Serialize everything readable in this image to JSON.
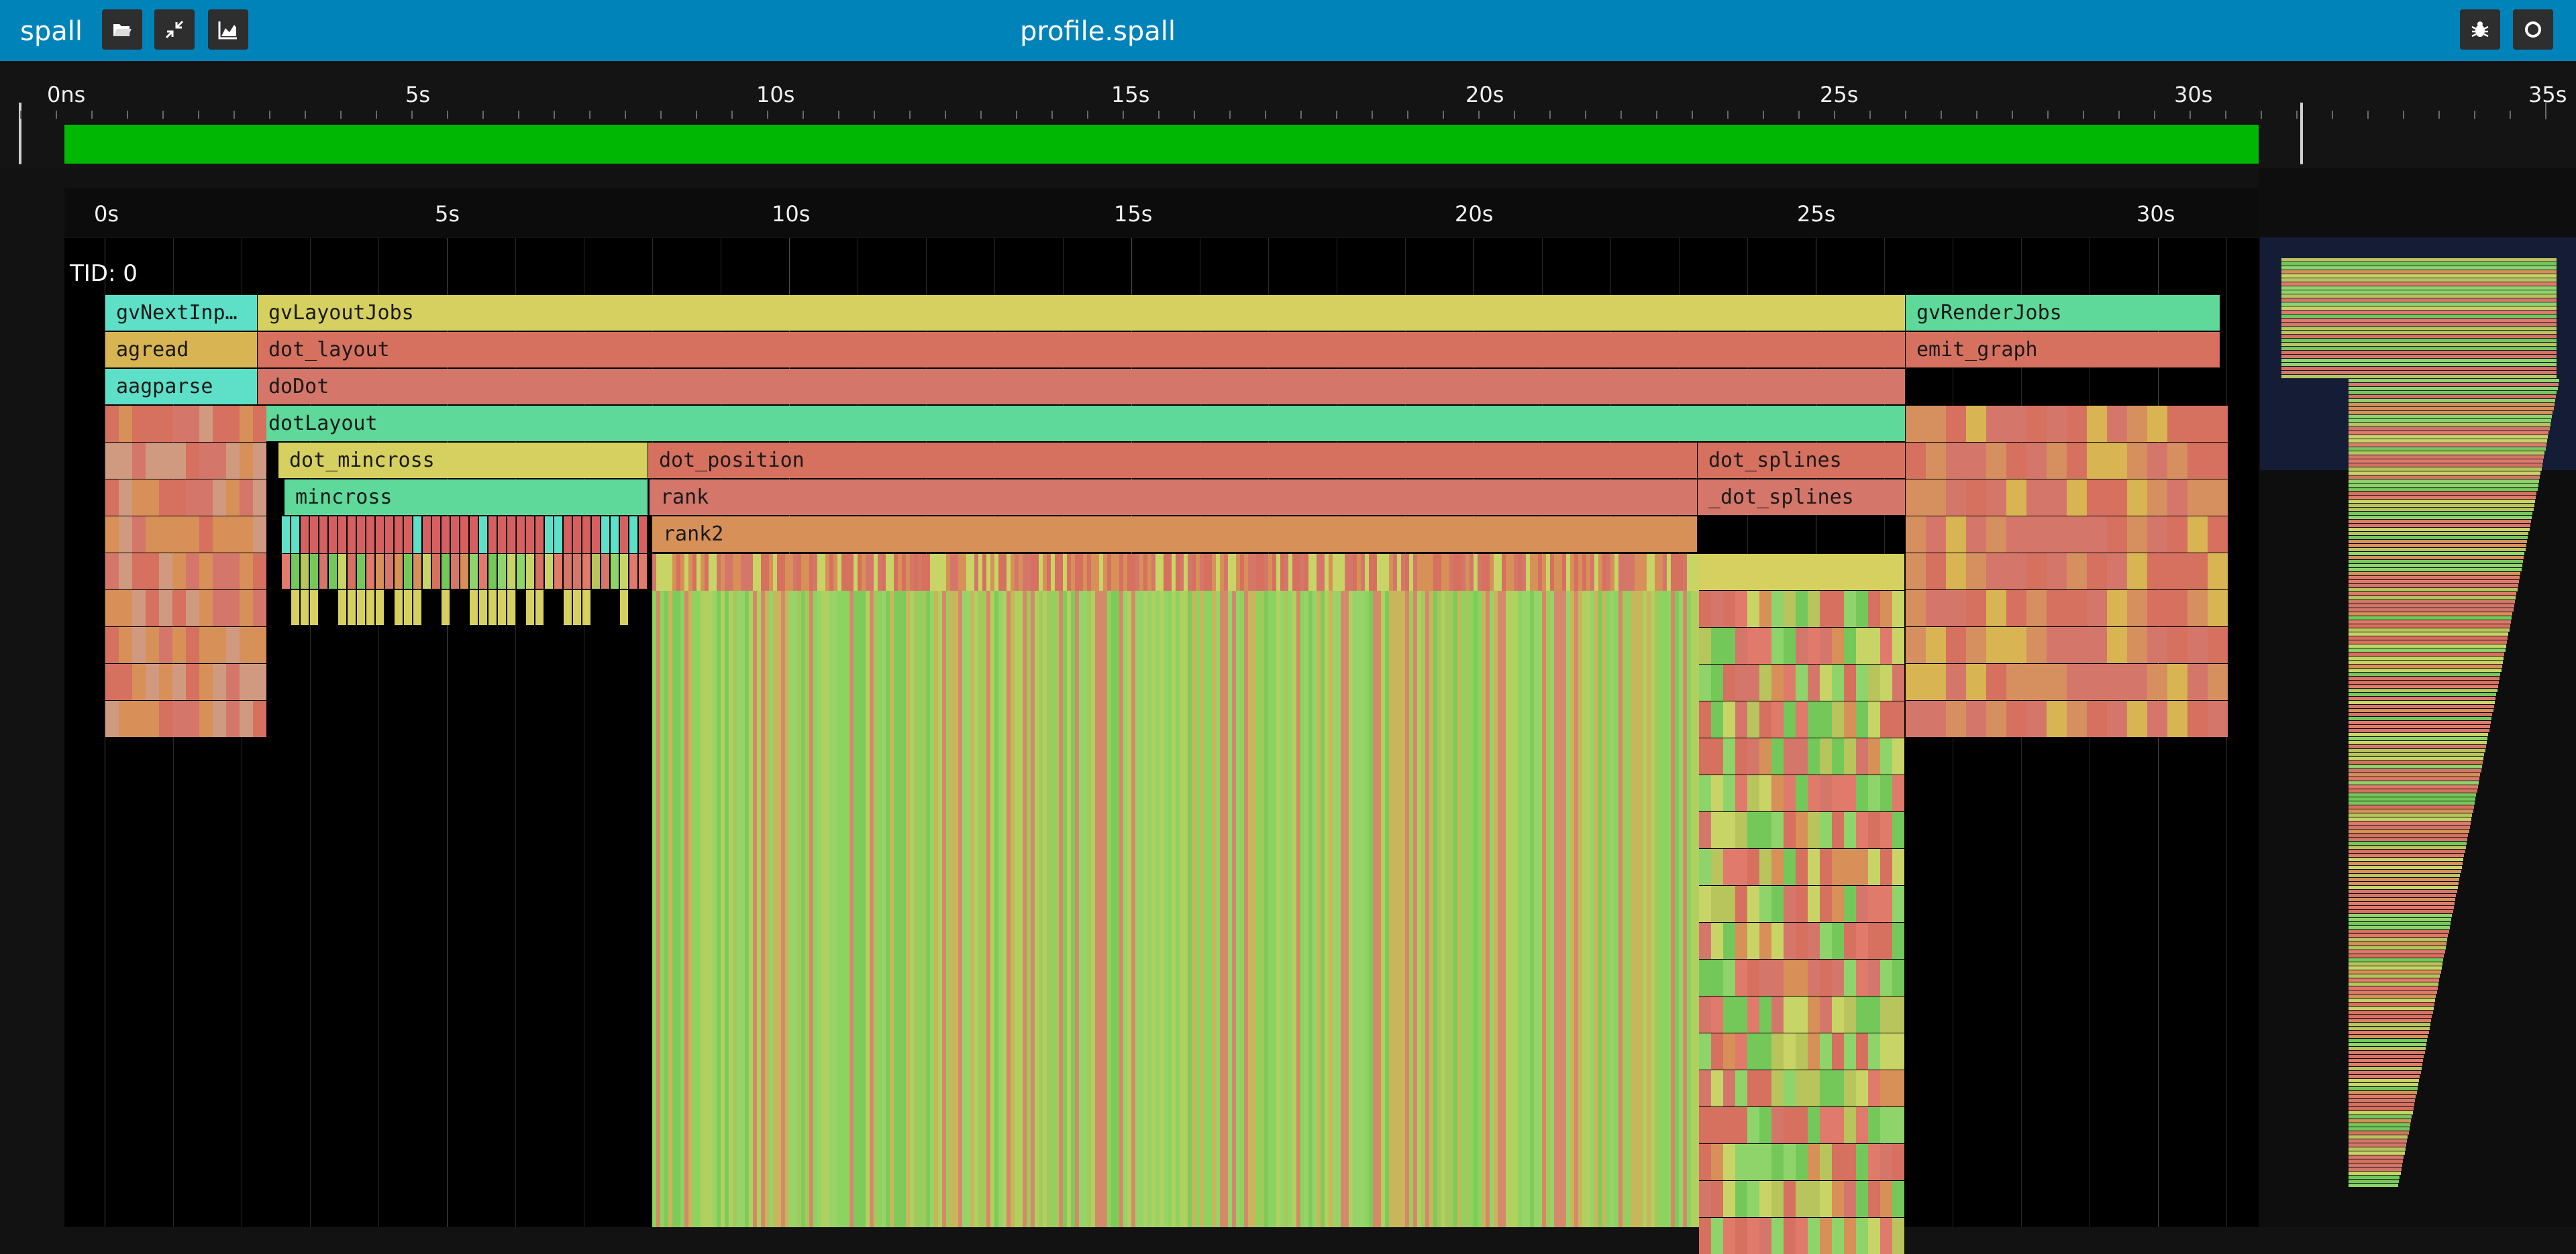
{
  "app": {
    "name": "spall",
    "file_title": "profile.spall"
  },
  "toolbar": {
    "left_icons": [
      "open-file-icon",
      "collapse-icon",
      "chart-icon"
    ],
    "right_icons": [
      "bug-icon",
      "record-icon"
    ]
  },
  "overview": {
    "tick_labels": [
      "0ns",
      "5s",
      "10s",
      "15s",
      "20s",
      "25s",
      "30s",
      "35s"
    ]
  },
  "ruler": {
    "tick_labels": [
      "0s",
      "5s",
      "10s",
      "15s",
      "20s",
      "25s",
      "30s"
    ]
  },
  "thread": {
    "label": "TID: 0"
  },
  "spans": [
    {
      "name": "gvNextInp…",
      "color": "#5ee0c8"
    },
    {
      "name": "gvLayoutJobs",
      "color": "#d6d060"
    },
    {
      "name": "gvRenderJobs",
      "color": "#5ed99a"
    },
    {
      "name": "agread",
      "color": "#d8b452"
    },
    {
      "name": "dot_layout",
      "color": "#d6705f"
    },
    {
      "name": "emit_graph",
      "color": "#d6705f"
    },
    {
      "name": "aagparse",
      "color": "#5ee0c8"
    },
    {
      "name": "doDot",
      "color": "#d4776a"
    },
    {
      "name": "dotLayout",
      "color": "#5ed99a"
    },
    {
      "name": "dot_mincross",
      "color": "#d6d060"
    },
    {
      "name": "dot_position",
      "color": "#d6705f"
    },
    {
      "name": "dot_splines",
      "color": "#d6705f"
    },
    {
      "name": "mincross",
      "color": "#5ed99a"
    },
    {
      "name": "rank",
      "color": "#d4776a"
    },
    {
      "name": "_dot_splines",
      "color": "#d4776a"
    },
    {
      "name": "rank2",
      "color": "#d69058"
    }
  ],
  "colors": {
    "topbar": "#0083b9",
    "overview_bar": "#00b804",
    "background": "#121212"
  }
}
